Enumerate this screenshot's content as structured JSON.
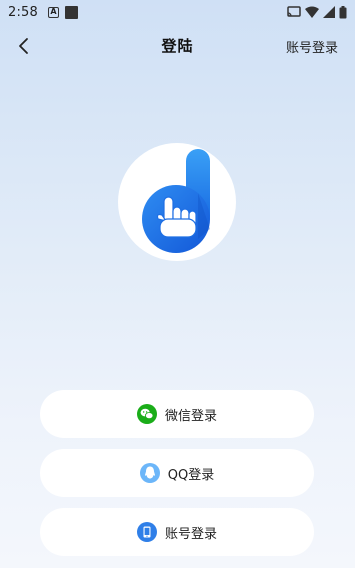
{
  "status_bar": {
    "time": "2:58",
    "notification_letter": "A"
  },
  "nav": {
    "title": "登陆",
    "account_login_link": "账号登录"
  },
  "login_buttons": [
    {
      "label": "微信登录",
      "icon": "wechat-icon",
      "icon_color": "#1aad19"
    },
    {
      "label": "QQ登录",
      "icon": "qq-icon",
      "icon_color": "#4fa3f7"
    },
    {
      "label": "账号登录",
      "icon": "phone-icon",
      "icon_color": "#2f7fe8"
    }
  ],
  "colors": {
    "logo_blue": "#1e7ef0",
    "background_top": "#cfe0f5",
    "background_bottom": "#f4f7fc"
  }
}
